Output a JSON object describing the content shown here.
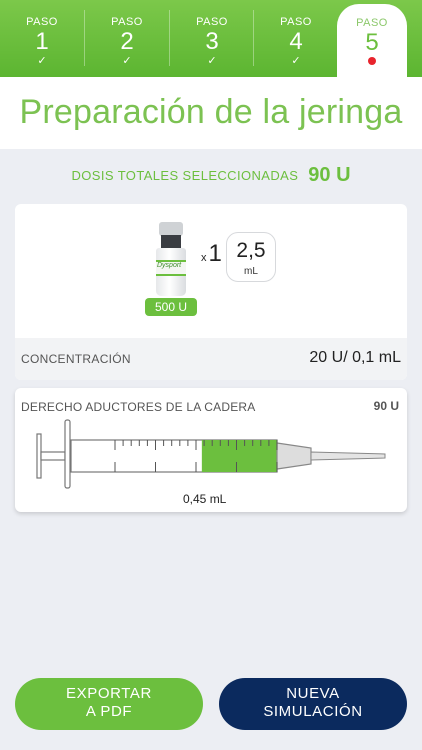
{
  "steps": [
    {
      "label": "PASO",
      "number": "1",
      "check": "✓"
    },
    {
      "label": "PASO",
      "number": "2",
      "check": "✓"
    },
    {
      "label": "PASO",
      "number": "3",
      "check": "✓"
    },
    {
      "label": "PASO",
      "number": "4",
      "check": "✓"
    },
    {
      "label": "PASO",
      "number": "5"
    }
  ],
  "page_title": "Preparación de la jeringa",
  "total_dose": {
    "label": "DOSIS TOTALES SELECCIONADAS",
    "value": "90 U"
  },
  "vial": {
    "brand": "Dysport",
    "units_badge": "500 U",
    "multiplier_x": "x",
    "multiplier_n": "1",
    "volume_value": "2,5",
    "volume_unit": "mL"
  },
  "concentration": {
    "label": "CONCENTRACIÓN",
    "value": "20 U/ 0,1 mL"
  },
  "syringe": {
    "muscle": "DERECHO ADUCTORES DE LA CADERA",
    "dose": "90 U",
    "volume": "0,45 mL",
    "fill_fraction": 0.45
  },
  "buttons": {
    "export_line1": "EXPORTAR",
    "export_line2": "A PDF",
    "new_line1": "NUEVA",
    "new_line2": "SIMULACIÓN"
  },
  "colors": {
    "brand_green": "#6cbf3e",
    "navy": "#0b2a5e",
    "active_dot": "#e8242d"
  }
}
